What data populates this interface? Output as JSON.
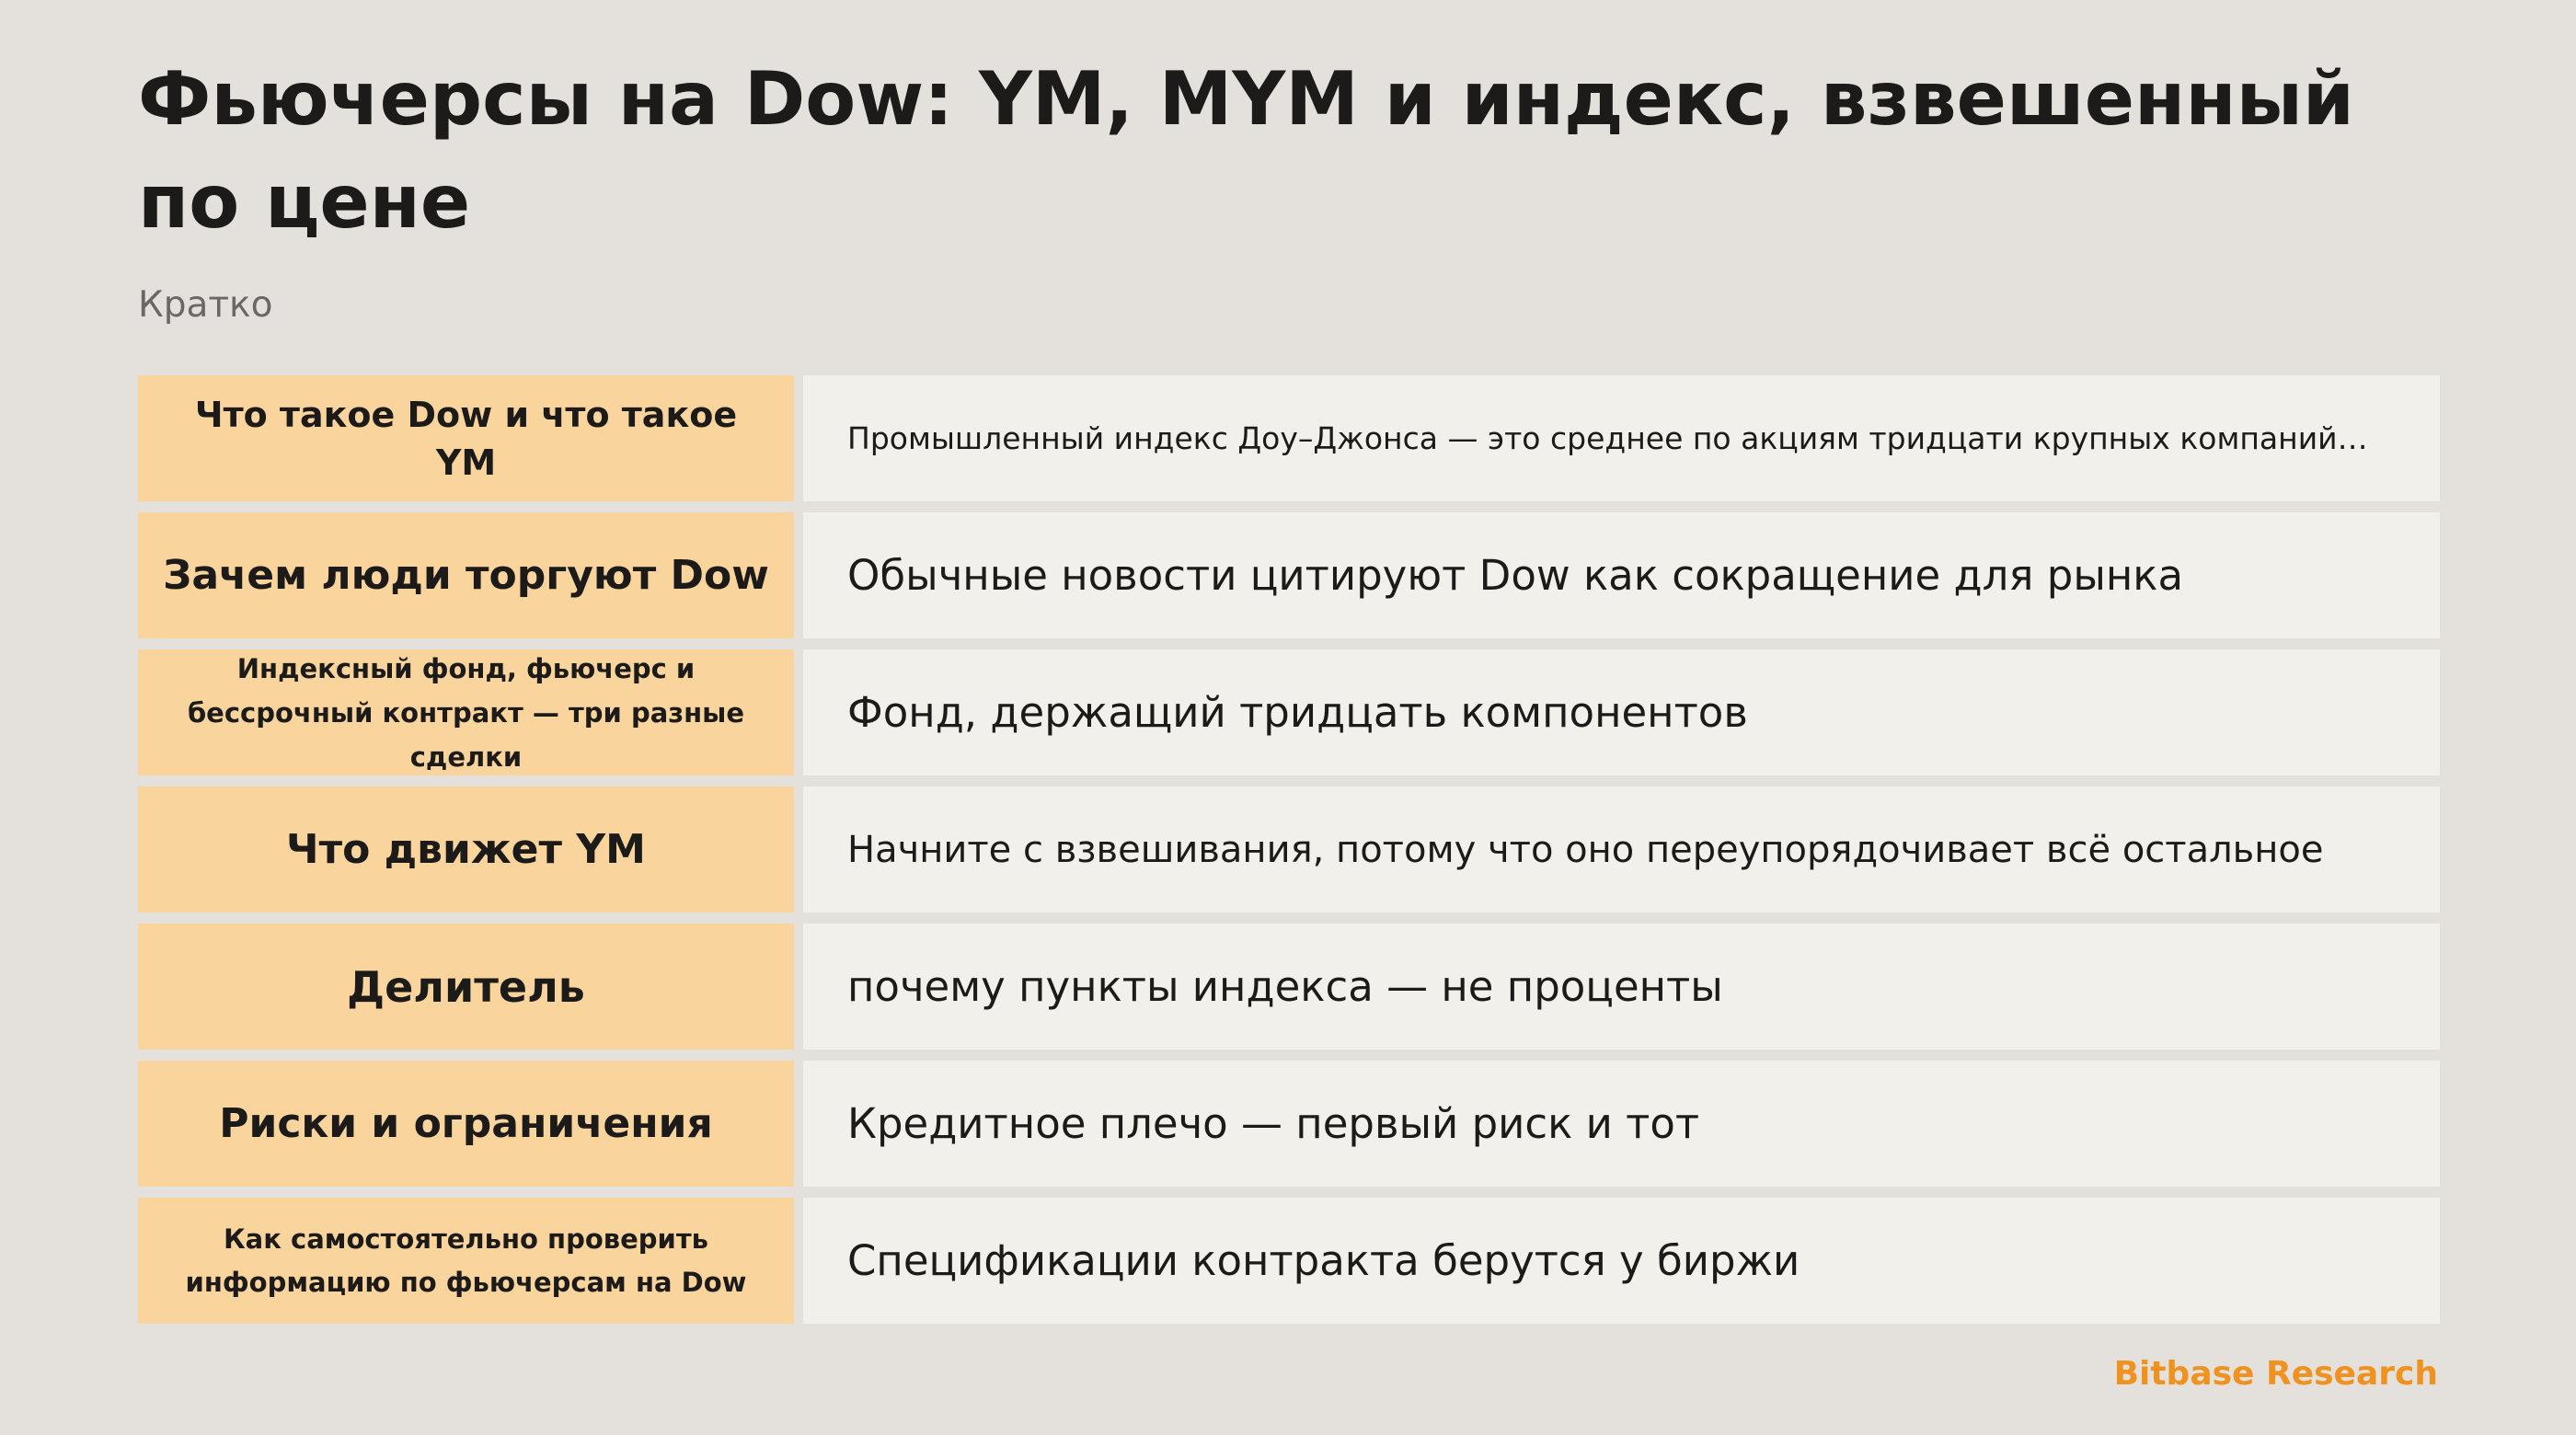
{
  "header": {
    "title": "Фьючерсы на Dow: YM, MYM и индекс, взвешенный по цене",
    "subtitle": "Кратко"
  },
  "rows": [
    {
      "label": "Что такое Dow и что такое YM",
      "text": "Промышленный индекс Доу–Джонса — это среднее по акциям тридцати крупных компаний…"
    },
    {
      "label": "Зачем люди торгуют Dow",
      "text": "Обычные новости цитируют Dow как сокращение для рынка"
    },
    {
      "label": "Индексный фонд, фьючерс и бессрочный контракт — три разные сделки",
      "text": "Фонд, держащий тридцать компонентов"
    },
    {
      "label": "Что движет YM",
      "text": "Начните с взвешивания, потому что оно переупорядочивает всё остальное"
    },
    {
      "label": "Делитель",
      "text": "почему пункты индекса — не проценты"
    },
    {
      "label": "Риски и ограничения",
      "text": "Кредитное плечо — первый риск и тот"
    },
    {
      "label": "Как самостоятельно проверить информацию по фьючерсам на Dow",
      "text": "Спецификации контракта берутся у биржи"
    }
  ],
  "footer": {
    "brand": "Bitbase Research"
  },
  "colors": {
    "background": "#e4e0db",
    "label_cell": "#f9d49d",
    "text_cell": "#f2f0eb",
    "brand": "#f0921f"
  }
}
